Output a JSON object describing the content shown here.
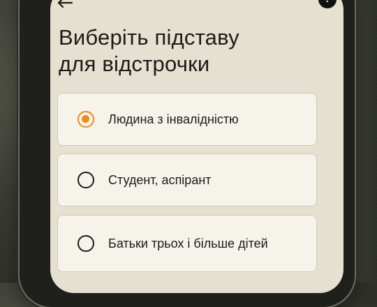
{
  "header": {
    "title_line1": "Виберіть підставу",
    "title_line2": "для відстрочки"
  },
  "options": [
    {
      "label": "Людина з інвалідністю",
      "selected": true
    },
    {
      "label": "Студент, аспірант",
      "selected": false
    },
    {
      "label": "Батьки трьох і більше дітей",
      "selected": false
    }
  ],
  "colors": {
    "accent": "#f08a1c",
    "screen_bg": "#e5e0cf",
    "card_bg": "#f6f3ea"
  },
  "icons": {
    "back": "arrow-left-icon",
    "help": "help-icon"
  }
}
